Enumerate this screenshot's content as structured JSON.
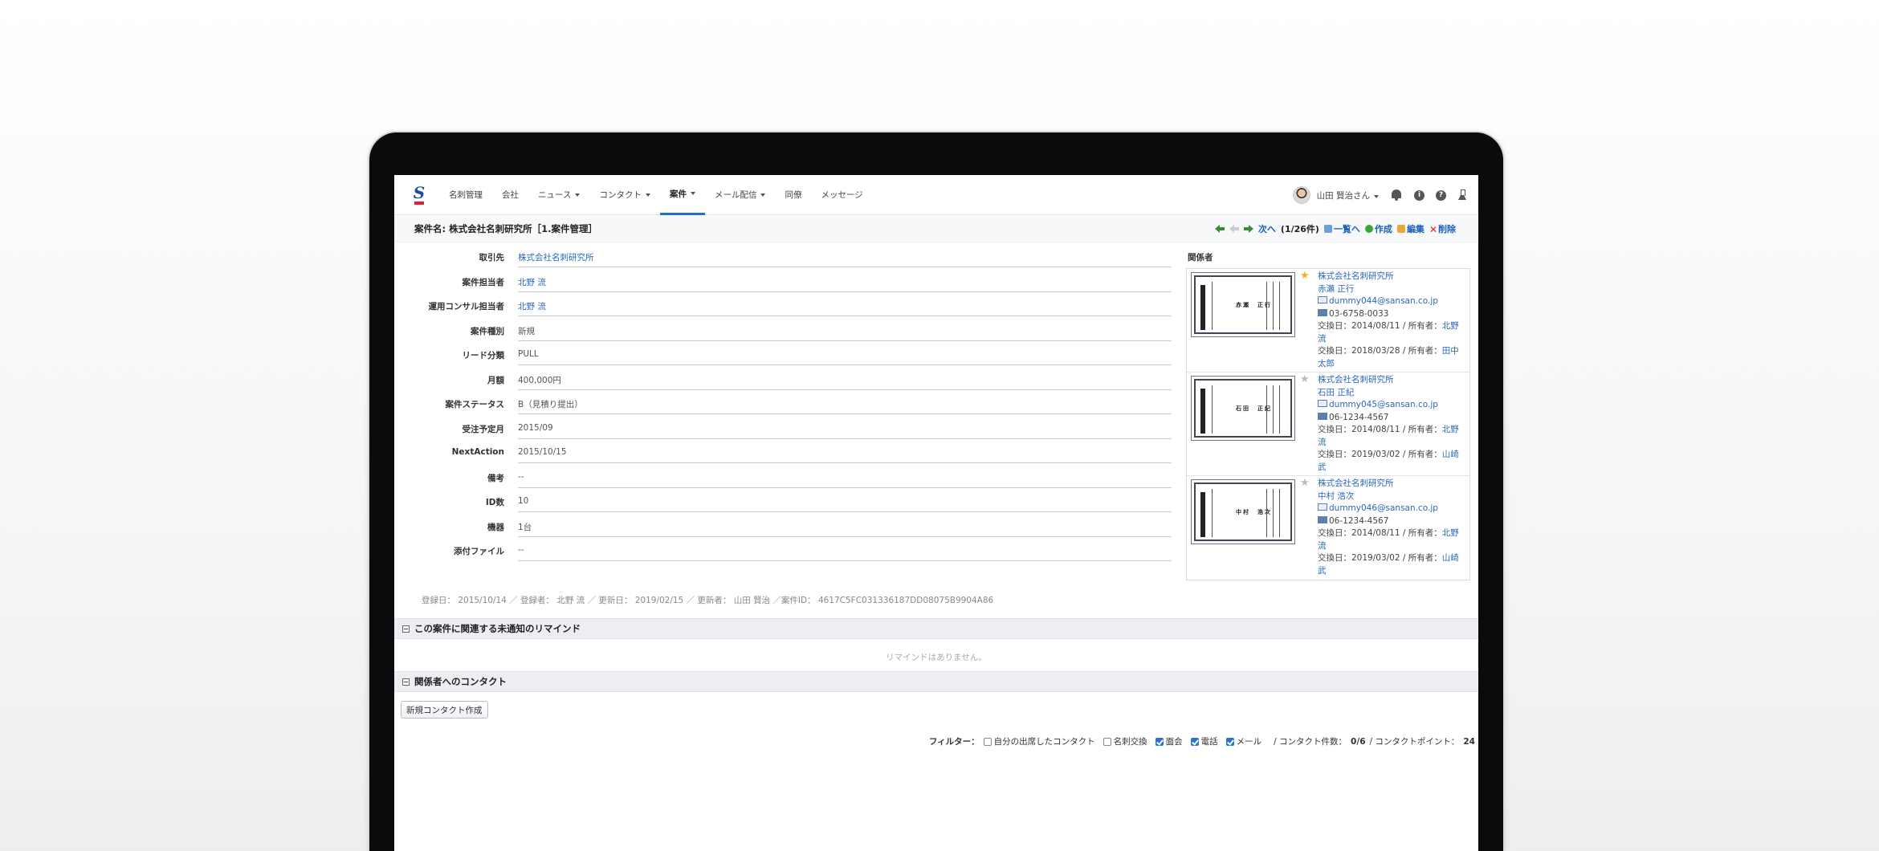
{
  "nav": {
    "logo": "S",
    "items": [
      {
        "label": "名刺管理",
        "dropdown": false,
        "active": false
      },
      {
        "label": "会社",
        "dropdown": false,
        "active": false
      },
      {
        "label": "ニュース",
        "dropdown": true,
        "active": false
      },
      {
        "label": "コンタクト",
        "dropdown": true,
        "active": false
      },
      {
        "label": "案件",
        "dropdown": true,
        "active": true
      },
      {
        "label": "メール配信",
        "dropdown": true,
        "active": false
      },
      {
        "label": "同僚",
        "dropdown": false,
        "active": false
      },
      {
        "label": "メッセージ",
        "dropdown": false,
        "active": false
      }
    ],
    "user_name": "山田 賢治さん"
  },
  "title_bar": {
    "title": "案件名: 株式会社名刺研究所［1.案件管理］",
    "next_label": "次へ",
    "count": "(1/26件)",
    "list_label": "一覧へ",
    "create_label": "作成",
    "edit_label": "編集",
    "delete_label": "削除"
  },
  "fields": [
    {
      "label": "取引先",
      "value": "株式会社名刺研究所",
      "link": true
    },
    {
      "label": "案件担当者",
      "value": "北野 流",
      "link": true
    },
    {
      "label": "運用コンサル担当者",
      "value": "北野 流",
      "link": true
    },
    {
      "label": "案件種別",
      "value": "新規",
      "link": false
    },
    {
      "label": "リード分類",
      "value": "PULL",
      "link": false
    },
    {
      "label": "月額",
      "value": "400,000円",
      "link": false
    },
    {
      "label": "案件ステータス",
      "value": "B（見積り提出）",
      "link": false
    },
    {
      "label": "受注予定月",
      "value": "2015/09",
      "link": false
    },
    {
      "label": "NextAction",
      "value": "2015/10/15",
      "link": false
    },
    {
      "label": "備考",
      "value": "--",
      "link": false
    },
    {
      "label": "ID数",
      "value": "10",
      "link": false
    },
    {
      "label": "機器",
      "value": "1台",
      "link": false
    },
    {
      "label": "添付ファイル",
      "value": "--",
      "link": false
    }
  ],
  "related": {
    "title": "関係者",
    "contacts": [
      {
        "favorite": true,
        "company": "株式会社名刺研究所",
        "name": "赤瀬 正行",
        "email": "dummy044@sansan.co.jp",
        "phone": "03-6758-0033",
        "exchange1_prefix": "交換日：2014/08/11 / 所有者：",
        "exchange1_owner": "北野 流",
        "exchange2_prefix": "交換日：2018/03/28 / 所有者：",
        "exchange2_owner": "田中 太郎",
        "card_name": "赤瀬　正行"
      },
      {
        "favorite": false,
        "company": "株式会社名刺研究所",
        "name": "石田 正紀",
        "email": "dummy045@sansan.co.jp",
        "phone": "06-1234-4567",
        "exchange1_prefix": "交換日：2014/08/11 / 所有者：",
        "exchange1_owner": "北野 流",
        "exchange2_prefix": "交換日：2019/03/02 / 所有者：",
        "exchange2_owner": "山崎 武",
        "card_name": "石田　正紀"
      },
      {
        "favorite": false,
        "company": "株式会社名刺研究所",
        "name": "中村 浩次",
        "email": "dummy046@sansan.co.jp",
        "phone": "06-1234-4567",
        "exchange1_prefix": "交換日：2014/08/11 / 所有者：",
        "exchange1_owner": "北野 流",
        "exchange2_prefix": "交換日：2019/03/02 / 所有者：",
        "exchange2_owner": "山崎 武",
        "card_name": "中村　浩次"
      }
    ]
  },
  "meta": "登録日： 2015/10/14 ／ 登録者： 北野 流 ／ 更新日： 2019/02/15 ／ 更新者： 山田 賢治 ／案件ID： 4617C5FC031336187DD08075B9904A86",
  "remind": {
    "title": "この案件に関連する未通知のリマインド",
    "empty": "リマインドはありません。"
  },
  "contact_section": {
    "title": "関係者へのコンタクト",
    "new_button": "新規コンタクト作成"
  },
  "filter": {
    "label": "フィルター：",
    "options": [
      {
        "label": "自分の出席したコンタクト",
        "checked": false
      },
      {
        "label": "名刺交換",
        "checked": false
      },
      {
        "label": "面会",
        "checked": true
      },
      {
        "label": "電話",
        "checked": true
      },
      {
        "label": "メール",
        "checked": true
      }
    ],
    "count_label": "/ コンタクト件数：",
    "count_value": "0/6",
    "points_label": "/ コンタクトポイント：",
    "points_value": "24"
  }
}
